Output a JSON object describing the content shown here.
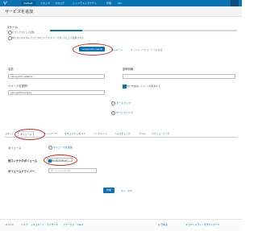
{
  "topbar": {
    "logo": "🐮",
    "env": "Default",
    "nav": [
      "スタック",
      "カタログ",
      "インフラストラクチャ",
      "管理",
      "API"
    ],
    "user_menu": "≡"
  },
  "page": {
    "title": "サービスを追加"
  },
  "scale": {
    "heading": "スケール",
    "opt_fixed": "1 コンテナとして起動",
    "opt_always": "常に全てのホストでひとつのコンテナをインスタンスとして起動させる",
    "btn_image": "nanogrid/h+nanot",
    "link_image": "のイメージ",
    "link_image2": "サイドキックのコンテナを追加"
  },
  "form": {
    "name_label": "名前",
    "name_value": "nanogrid-h-network",
    "desc_label": "説明情報",
    "image_label": "イメージを選択*",
    "image_value": "nanogrid/nanogrid",
    "pull_label": "常に作成前にイメージを取得する",
    "port_map_link": "ポートマップ",
    "service_link_link": "サービスリンク"
  },
  "tabs": [
    "コマンド",
    "ボリューム",
    "ネットワーク",
    "セキュリティ/ホスト",
    "シークレット",
    "ヘルスチェック",
    "ラベル",
    "スケジューリング"
  ],
  "volumes": {
    "volume_label": "ボリューム",
    "add_volume": "ボリュームを追加",
    "from_label": "他コンテナのボリューム",
    "from_value": "nanogrid-server",
    "driver_label": "ボリュームドライバー",
    "driver_placeholder": "例: convoy-gluster"
  },
  "actions": {
    "create": "作成",
    "cancel": "キャンセル"
  },
  "footer": {
    "links": [
      "v1.6.10",
      "ヘルプ",
      "ドキュメント",
      "ライセンス",
      "フォーラム",
      "Slack"
    ],
    "lang": "日本語",
    "cli": "コマンドラインをダウンロード"
  }
}
